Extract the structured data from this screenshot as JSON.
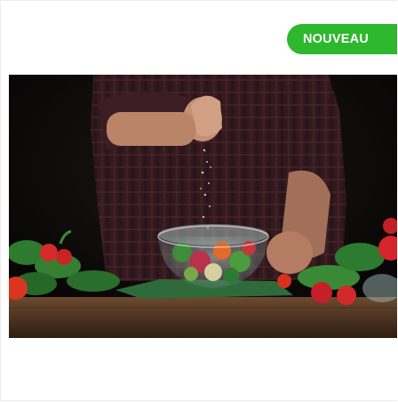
{
  "card": {
    "badge_label": "NOUVEAU",
    "badge_color": "#2db82d",
    "image_subject": "chef-seasoning-salad-photo"
  }
}
